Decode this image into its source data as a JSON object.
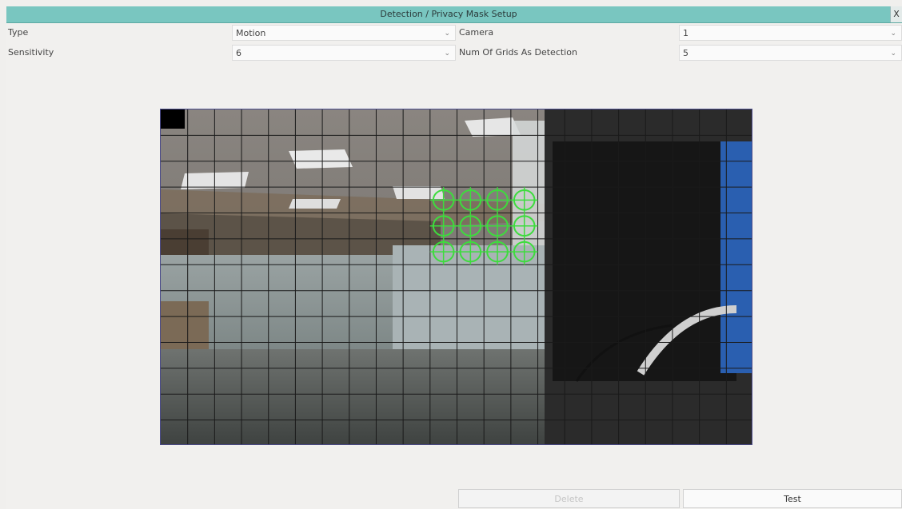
{
  "window": {
    "title": "Detection / Privacy Mask Setup",
    "close_label": "X"
  },
  "settings": {
    "type": {
      "label": "Type",
      "value": "Motion"
    },
    "camera": {
      "label": "Camera",
      "value": "1"
    },
    "sensitivity": {
      "label": "Sensitivity",
      "value": "6"
    },
    "num_grids": {
      "label": "Num Of Grids As Detection",
      "value": "5"
    },
    "dropdown_glyph": "⌄"
  },
  "grid": {
    "columns": 22,
    "rows": 13,
    "selected_cells": [
      [
        10,
        3
      ],
      [
        11,
        3
      ],
      [
        12,
        3
      ],
      [
        13,
        3
      ],
      [
        10,
        4
      ],
      [
        11,
        4
      ],
      [
        12,
        4
      ],
      [
        13,
        4
      ],
      [
        10,
        5
      ],
      [
        11,
        5
      ],
      [
        12,
        5
      ],
      [
        13,
        5
      ]
    ],
    "line_color": "#1a1a1a",
    "selected_color": "#3ddc3d"
  },
  "buttons": {
    "delete_label": "Delete",
    "test_label": "Test"
  }
}
